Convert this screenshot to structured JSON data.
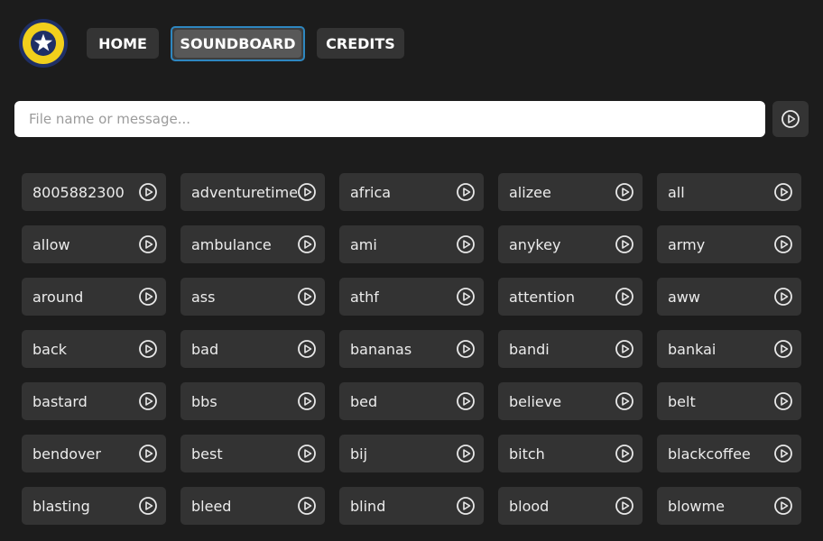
{
  "nav": {
    "home": "HOME",
    "soundboard": "SOUNDBOARD",
    "credits": "CREDITS"
  },
  "search": {
    "placeholder": "File name or message...",
    "value": ""
  },
  "colors": {
    "background": "#1c1c1c",
    "button": "#333333",
    "active_border": "#2e87c0",
    "logo_yellow": "#f1cf1c",
    "logo_navy": "#1f2f66"
  },
  "icons": {
    "logo": "star-icon",
    "play": "play-circle-icon"
  },
  "sounds": [
    "8005882300",
    "adventuretime",
    "africa",
    "alizee",
    "all",
    "allow",
    "ambulance",
    "ami",
    "anykey",
    "army",
    "around",
    "ass",
    "athf",
    "attention",
    "aww",
    "back",
    "bad",
    "bananas",
    "bandi",
    "bankai",
    "bastard",
    "bbs",
    "bed",
    "believe",
    "belt",
    "bendover",
    "best",
    "bij",
    "bitch",
    "blackcoffee",
    "blasting",
    "bleed",
    "blind",
    "blood",
    "blowme"
  ]
}
